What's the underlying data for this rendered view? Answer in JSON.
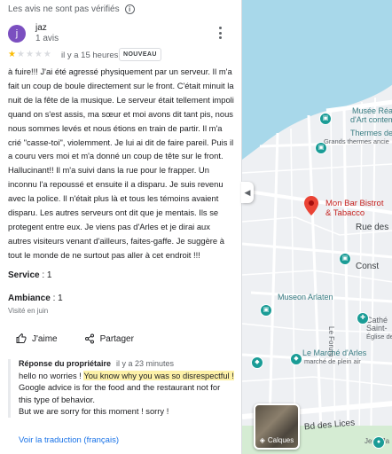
{
  "header": {
    "note": "Les avis ne sont pas vérifiés"
  },
  "reviewer": {
    "initial": "j",
    "name": "jaz",
    "review_count": "1 avis",
    "avatar_color": "#7b4fc0"
  },
  "rating": {
    "stars": 1,
    "max": 5,
    "time": "il y a 15 heures",
    "badge": "NOUVEAU"
  },
  "review": {
    "text": "à fuire!!! J'ai été agressé physiquement par un serveur. Il m'a fait un coup de boule directement sur le front. C'était minuit la nuit de la fête de la musique. Le serveur était tellement impoli quand on s'est assis, ma sœur et moi avons dit tant pis, nous nous sommes levés et nous étions en train de partir. Il m'a crié \"casse-toi\", violemment. Je lui ai dit de faire pareil. Puis il a couru vers moi et m'a donné un coup de tête sur le front. Hallucinant!! Il m'a suivi dans la rue pour le frapper. Un inconnu l'a repoussé et ensuite il a disparu. Je suis revenu avec la police. Il n'était plus là et tous les témoins avaient disparu. Les autres serveurs ont dit que je mentais. Ils se protegent entre eux. Je viens pas d'Arles et je dirai aux autres visiteurs venant d'ailleurs, faites-gaffe. Je suggère à tout le monde de ne surtout pas aller à cet endroit !!!"
  },
  "attributes": {
    "service_label": "Service",
    "service_value": ": 1",
    "ambiance_label": "Ambiance",
    "ambiance_value": ": 1",
    "visited": "Visité en juin"
  },
  "actions": {
    "like": "J'aime",
    "share": "Partager"
  },
  "owner_reply": {
    "label": "Réponse du propriétaire",
    "time": "il y a 23 minutes",
    "line1": "hello no worries ! ",
    "highlight": "You know why you was so disrespectful !",
    "rest": " Google advice is for the food and the restaurant not for this type of behavior.",
    "line3": "But we are sorry for this moment ! sorry !"
  },
  "translate_link": "Voir la traduction (français)",
  "map": {
    "labels": {
      "musee1": "Musée Réa",
      "musee2": "d'Art contempo",
      "thermes1": "Thermes de Const",
      "thermes2": "Grands thermes ancie",
      "place1": "Mon Bar Bistrot",
      "place2": "& Tabacco",
      "rue": "Rue des",
      "museon": "Museon Arlaten",
      "cathe1": "Cathé",
      "cathe2": "Saint-",
      "cathe3": "Église de",
      "forum": "Le Forum",
      "marche1": "Le Marché d'Arles",
      "marche2": "marché de plein air",
      "lices": "Bd des Lices",
      "jean": "Jean Ja",
      "const": "Const",
      "layers": "Calques"
    },
    "colors": {
      "water": "#a8d8ea",
      "land": "#eef0f3",
      "road": "#ffffff",
      "pin": "#ea4335",
      "poi": "#1a9c96"
    }
  }
}
